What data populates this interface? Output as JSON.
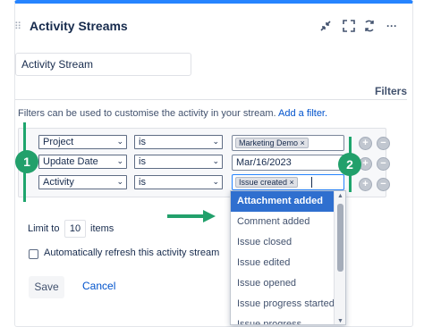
{
  "gadget": {
    "title": "Activity Streams",
    "title_input_value": "Activity Stream",
    "tools": [
      "minimize-icon",
      "maximize-icon",
      "refresh-icon",
      "more-icon"
    ],
    "more_label": "···"
  },
  "filters": {
    "heading": "Filters",
    "description": "Filters can be used to customise the activity in your stream.",
    "add_link": "Add a filter.",
    "rows": [
      {
        "field": "Project",
        "operator": "is",
        "value_tag": "Marketing Demo"
      },
      {
        "field": "Update Date",
        "operator": "is",
        "value_text": "Mar/16/2023"
      },
      {
        "field": "Activity",
        "operator": "is",
        "value_tag": "Issue created"
      }
    ]
  },
  "limit": {
    "label": "Limit to",
    "value": "10",
    "suffix": "items"
  },
  "auto_refresh": {
    "label": "Automatically refresh this activity stream",
    "checked": false
  },
  "buttons": {
    "save": "Save",
    "cancel": "Cancel"
  },
  "dropdown": {
    "items": [
      "Attachment added",
      "Comment added",
      "Issue closed",
      "Issue edited",
      "Issue opened",
      "Issue progress started",
      "Issue progress"
    ],
    "active_index": 0
  },
  "annotations": {
    "badge_1": "1",
    "badge_2": "2"
  },
  "colors": {
    "accent": "#2684ff",
    "link": "#0052cc",
    "highlight": "#2f6fcf",
    "annotation_green": "#22a06b"
  }
}
